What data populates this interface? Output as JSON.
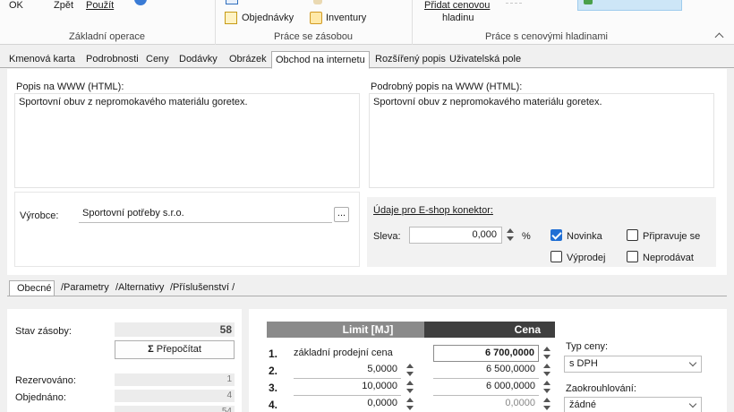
{
  "ribbon": {
    "ok": "OK",
    "back": "Zpět",
    "apply": "Použít",
    "orders": "Objednávky",
    "inventory": "Inventury",
    "add_price_level_1": "Přidat cenovou",
    "add_price_level_2": "hladinu",
    "group_basic": "Základní operace",
    "group_stock": "Práce se zásobou",
    "group_price": "Práce s cenovými hladinami"
  },
  "tabs": [
    "Kmenová karta",
    "Podrobnosti",
    "Ceny",
    "Dodávky",
    "Obrázek",
    "Obchod na internetu",
    "Rozšířený popis",
    "Uživatelská pole"
  ],
  "web": {
    "desc_label": "Popis na WWW (HTML):",
    "desc_value": "Sportovní obuv z nepromokavého materiálu goretex.",
    "detail_label": "Podrobný popis na WWW (HTML):",
    "detail_value": "Sportovní obuv z nepromokavého materiálu goretex.",
    "manufacturer_label": "Výrobce:",
    "manufacturer_value": "Sportovní potřeby s.r.o.",
    "browse_button": "...",
    "eshop_heading": "Údaje pro E-shop konektor:",
    "discount_label": "Sleva:",
    "discount_value": "0,000",
    "discount_unit": "%",
    "new_label": "Novinka",
    "preparing_label": "Připravuje se",
    "sale_label": "Výprodej",
    "not_for_sale_label": "Neprodávat",
    "new_checked": true,
    "preparing_checked": false,
    "sale_checked": false,
    "not_for_sale_checked": false
  },
  "subtabs": [
    "Obecné",
    "Parametry",
    "Alternativy",
    "Příslušenství"
  ],
  "stock": {
    "stav_label": "Stav zásoby:",
    "stav_value": "58",
    "recalc_button": "Přepočítat",
    "reserved_label": "Rezervováno:",
    "reserved_value": "1",
    "ordered_label": "Objednáno:",
    "ordered_value": "4",
    "partial_value": "54"
  },
  "prices": {
    "header_limit": "Limit [MJ]",
    "header_price": "Cena",
    "rows": [
      {
        "num": "1.",
        "limit": "základní prodejní cena",
        "price": "6 700,0000"
      },
      {
        "num": "2.",
        "limit": "5,0000",
        "price": "6 500,0000"
      },
      {
        "num": "3.",
        "limit": "10,0000",
        "price": "6 000,0000"
      },
      {
        "num": "4.",
        "limit": "0,0000",
        "price": "0,0000"
      }
    ],
    "type_label": "Typ ceny:",
    "type_value": "s DPH",
    "rounding_label": "Zaokrouhlování:",
    "rounding_value": "žádné"
  }
}
